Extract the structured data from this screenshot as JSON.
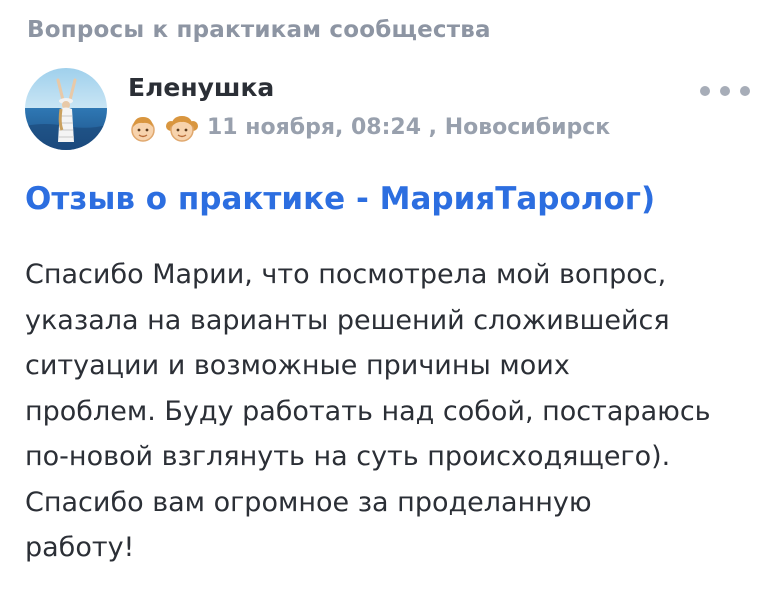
{
  "section": {
    "title": "Вопросы к практикам сообщества"
  },
  "post": {
    "author": "Еленушка",
    "avatar_icon": "avatar-photo-beach",
    "badges": [
      "boy-face-icon",
      "girl-face-icon"
    ],
    "date": "11 ноября, 08:24",
    "separator": " , ",
    "city": "Новосибирск",
    "more_icon": "more-dots-icon",
    "title": "Отзыв о практике - МарияТаролог)",
    "body_lines": [
      "Спасибо Марии, что посмотрела мой вопрос,",
      "указала на варианты решений сложившейся",
      "ситуации и возможные причины моих",
      "проблем. Буду работать над собой, постараюсь",
      "по-новой взглянуть на суть происходящего).",
      "Спасибо вам огромное за проделанную",
      "работу!"
    ]
  },
  "colors": {
    "accent": "#2c6ee0",
    "muted": "#8d95a3",
    "text": "#2b2f36"
  }
}
